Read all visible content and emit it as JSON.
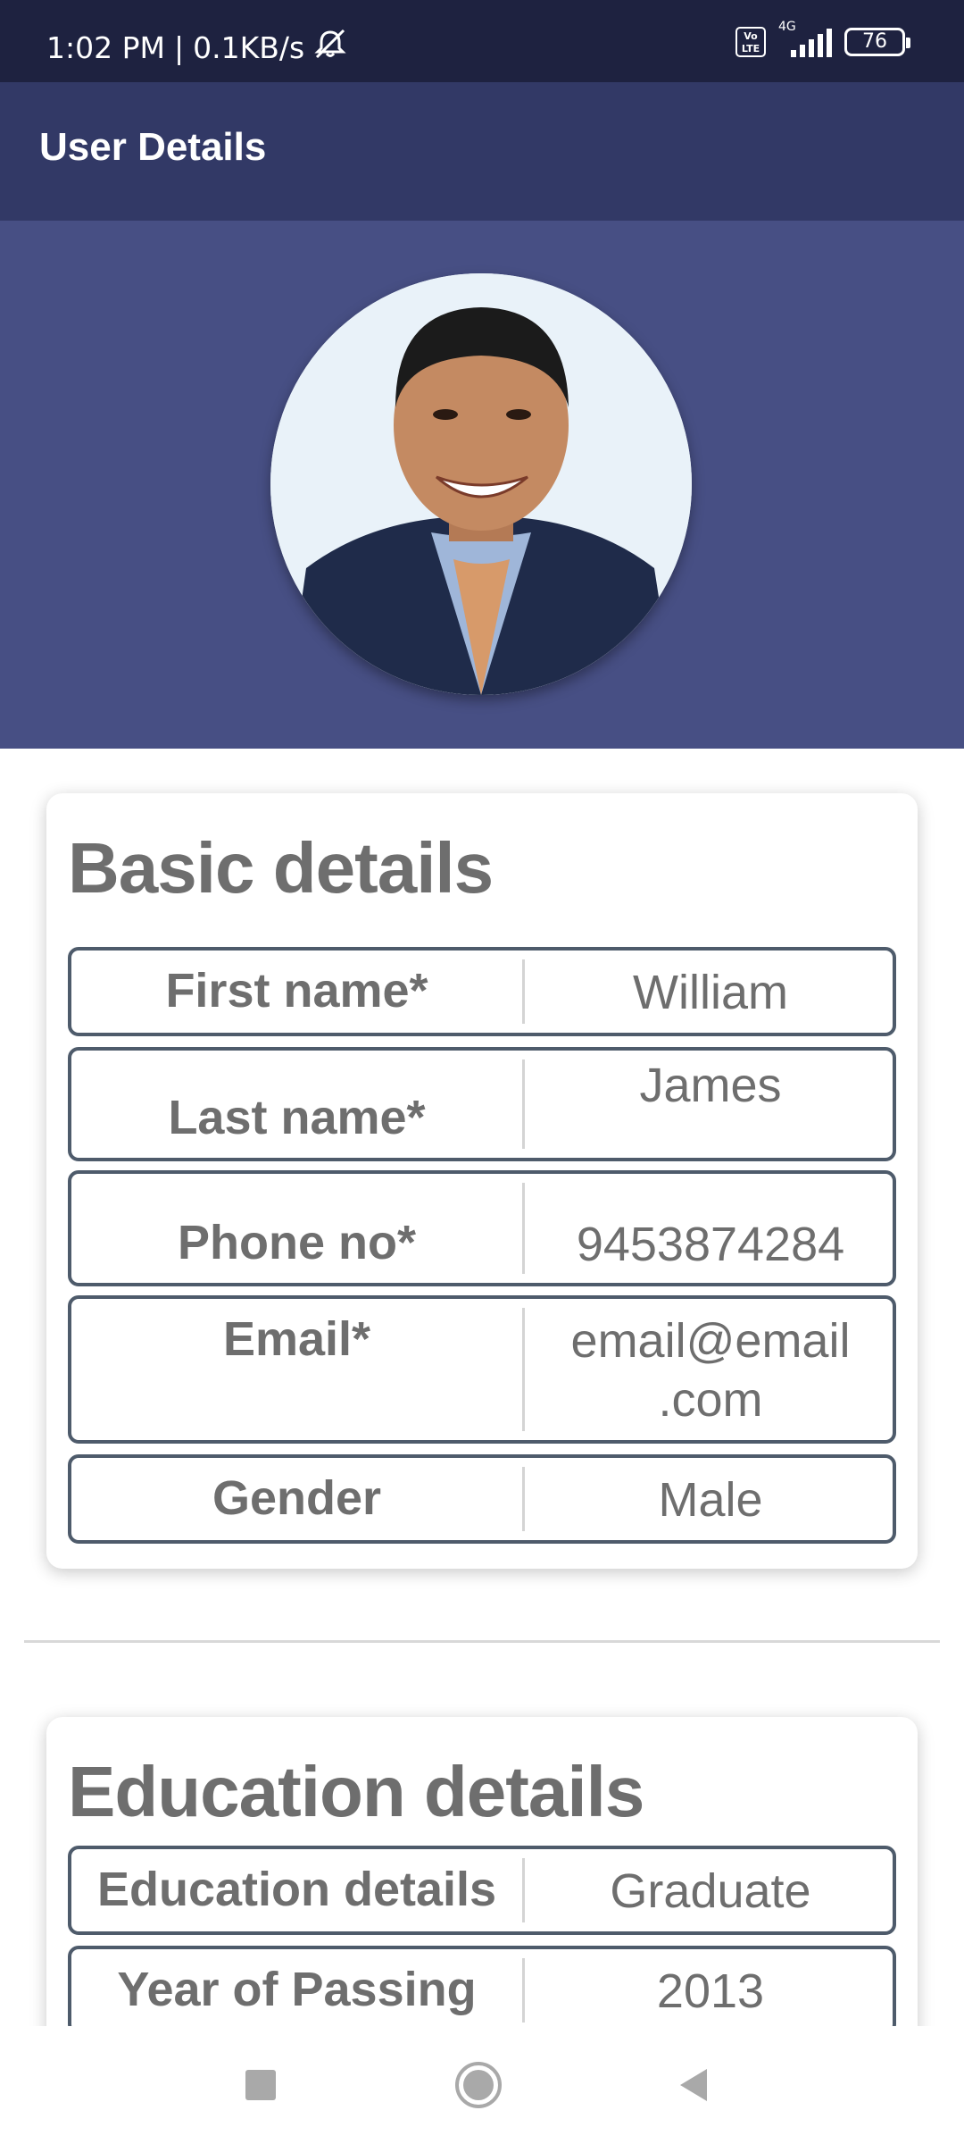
{
  "status_bar": {
    "time": "1:02 PM",
    "network_speed": "0.1KB/s",
    "separator": "|",
    "volte_label": "Vo LTE",
    "network_type": "4G",
    "battery_level": "76",
    "icons": [
      "mute-icon",
      "volte-icon",
      "signal-icon",
      "battery-icon"
    ]
  },
  "app_bar": {
    "title": "User Details"
  },
  "profile": {
    "avatar": "profile-photo"
  },
  "basic_details": {
    "title": "Basic details",
    "rows": [
      {
        "label": "First name*",
        "value": "William"
      },
      {
        "label": "Last name*",
        "value": "James"
      },
      {
        "label": "Phone no*",
        "value": "9453874284"
      },
      {
        "label": "Email*",
        "value": "email@email\n.com"
      },
      {
        "label": "Gender",
        "value": "Male"
      }
    ]
  },
  "education_details": {
    "title": "Education details",
    "rows": [
      {
        "label": "Education details",
        "value": "Graduate"
      },
      {
        "label": "Year of Passing",
        "value": "2013"
      }
    ]
  },
  "nav_bar": {
    "buttons": [
      "recents-button",
      "home-button",
      "back-button"
    ]
  },
  "colors": {
    "status_bar": "#1e2240",
    "app_bar": "#323966",
    "header_band": "#474f84",
    "text_gray": "#6e6e6e",
    "row_border": "#4e5b6b"
  }
}
